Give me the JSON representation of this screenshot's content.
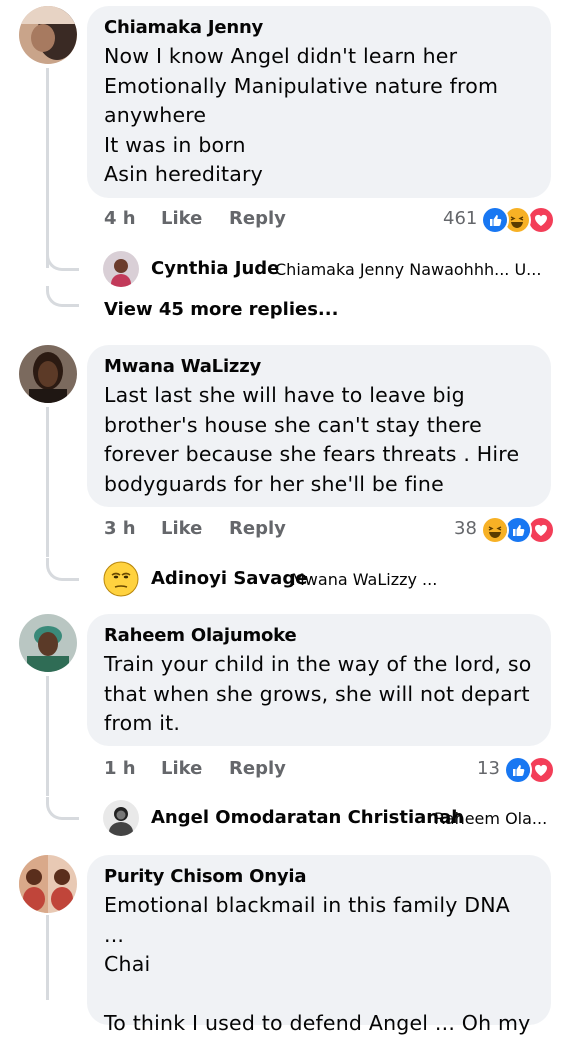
{
  "comments": [
    {
      "author": "Chiamaka Jenny",
      "lines": "Now I know Angel didn't learn her\nEmotionally Manipulative nature from\nanywhere\nIt was in born\nAsin hereditary",
      "time": "4 h",
      "like": "Like",
      "reply": "Reply",
      "reaction_count": "461",
      "reactions": [
        "like-reaction-icon",
        "haha-reaction-icon",
        "love-reaction-icon"
      ]
    },
    {
      "author": "Mwana WaLizzy",
      "lines": "Last last she will have to leave big\nbrother's house she can't stay there\nforever because she fears threats . Hire\nbodyguards for her she'll be fine",
      "time": "3 h",
      "like": "Like",
      "reply": "Reply",
      "reaction_count": "38",
      "reactions": [
        "haha-reaction-icon",
        "like-reaction-icon",
        "love-reaction-icon"
      ]
    },
    {
      "author": "Raheem Olajumoke",
      "lines": "Train your child in the way of the lord, so\nthat when she grows, she will not depart\nfrom it.",
      "time": "1 h",
      "like": "Like",
      "reply": "Reply",
      "reaction_count": "13",
      "reactions": [
        "like-reaction-icon",
        "love-reaction-icon"
      ]
    },
    {
      "author": "Purity Chisom Onyia",
      "lines": "Emotional blackmail in this family DNA ...\nChai\n\nTo think I used to defend Angel ... Oh my"
    }
  ],
  "replies": [
    {
      "name": "Cynthia Jude",
      "text": "Chiamaka Jenny Nawaohhh... U..."
    },
    {
      "name": "Adinoyi Savage",
      "text": "Mwana WaLizzy ..."
    },
    {
      "name": "Angel Omodaratan Christianah",
      "text": "Raheem Ola..."
    }
  ],
  "view_more": "View 45 more replies...",
  "colors": {
    "bubble": "#f0f2f5",
    "like_blue": "#1877f2",
    "love_red": "#f33e58",
    "haha_yellow": "#f7b125",
    "thread_line": "#d7dade"
  }
}
